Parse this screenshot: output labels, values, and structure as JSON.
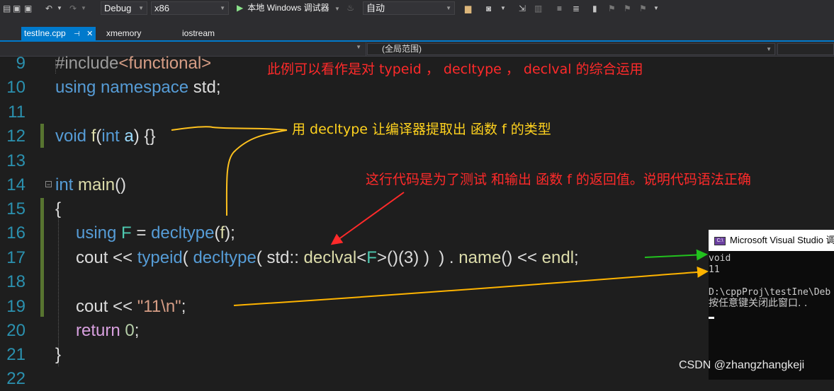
{
  "toolbar": {
    "config": "Debug",
    "platform": "x86",
    "run_label": "本地 Windows 调试器",
    "auto_label": "自动"
  },
  "tabs": [
    {
      "label": "testIne.cpp",
      "active": true
    },
    {
      "label": "xmemory",
      "active": false
    },
    {
      "label": "iostream",
      "active": false
    }
  ],
  "navbar": {
    "scope": "(全局范围)"
  },
  "line_numbers": [
    "9",
    "10",
    "11",
    "12",
    "13",
    "14",
    "15",
    "16",
    "17",
    "18",
    "19",
    "20",
    "21",
    "22"
  ],
  "code_lines": {
    "l9_a": "#include",
    "l9_b": "<functional>",
    "l10_a": "using",
    "l10_b": "namespace",
    "l10_c": "std;",
    "l12_a": "void",
    "l12_b": "f",
    "l12_c": "(",
    "l12_d": "int",
    "l12_e": "a",
    "l12_f": ") {}",
    "l14_a": "int",
    "l14_b": "main",
    "l14_c": "()",
    "l15": "{",
    "l16_a": "using",
    "l16_b": "F",
    "l16_c": " = ",
    "l16_d": "decltype",
    "l16_e": "(",
    "l16_f": "f",
    "l16_g": ");",
    "l17_a": "cout << ",
    "l17_b": "typeid",
    "l17_c": "( ",
    "l17_d": "decltype",
    "l17_e": "( std:: ",
    "l17_f": "declval",
    "l17_g": "<",
    "l17_h": "F",
    "l17_i": ">()(3) )  ) . ",
    "l17_j": "name",
    "l17_k": "() << ",
    "l17_l": "endl",
    "l17_m": ";",
    "l19_a": "cout << ",
    "l19_b": "\"11\\n\"",
    "l19_c": ";",
    "l20_a": "return",
    "l20_b": "0",
    "l20_c": ";",
    "l21": "}"
  },
  "annotations": {
    "top": "此例可以看作是对 typeid ，  decltype ，  declval 的综合运用",
    "decltype_note": "用 decltype 让编译器提取出 函数 f  的类型",
    "test_note": "这行代码是为了测试 和输出 函数 f 的返回值。说明代码语法正确"
  },
  "console": {
    "title": "Microsoft Visual Studio 调",
    "lines": [
      "void",
      "11",
      "",
      "D:\\cppProj\\testIne\\Deb",
      "按任意键关闭此窗口. ."
    ]
  },
  "watermark": "CSDN @zhangzhangkeji",
  "colors": {
    "accent": "#007acc",
    "annotation_red": "#ff2a2a",
    "annotation_yellow": "#ffd21e",
    "arrow_green": "#22c21e"
  }
}
